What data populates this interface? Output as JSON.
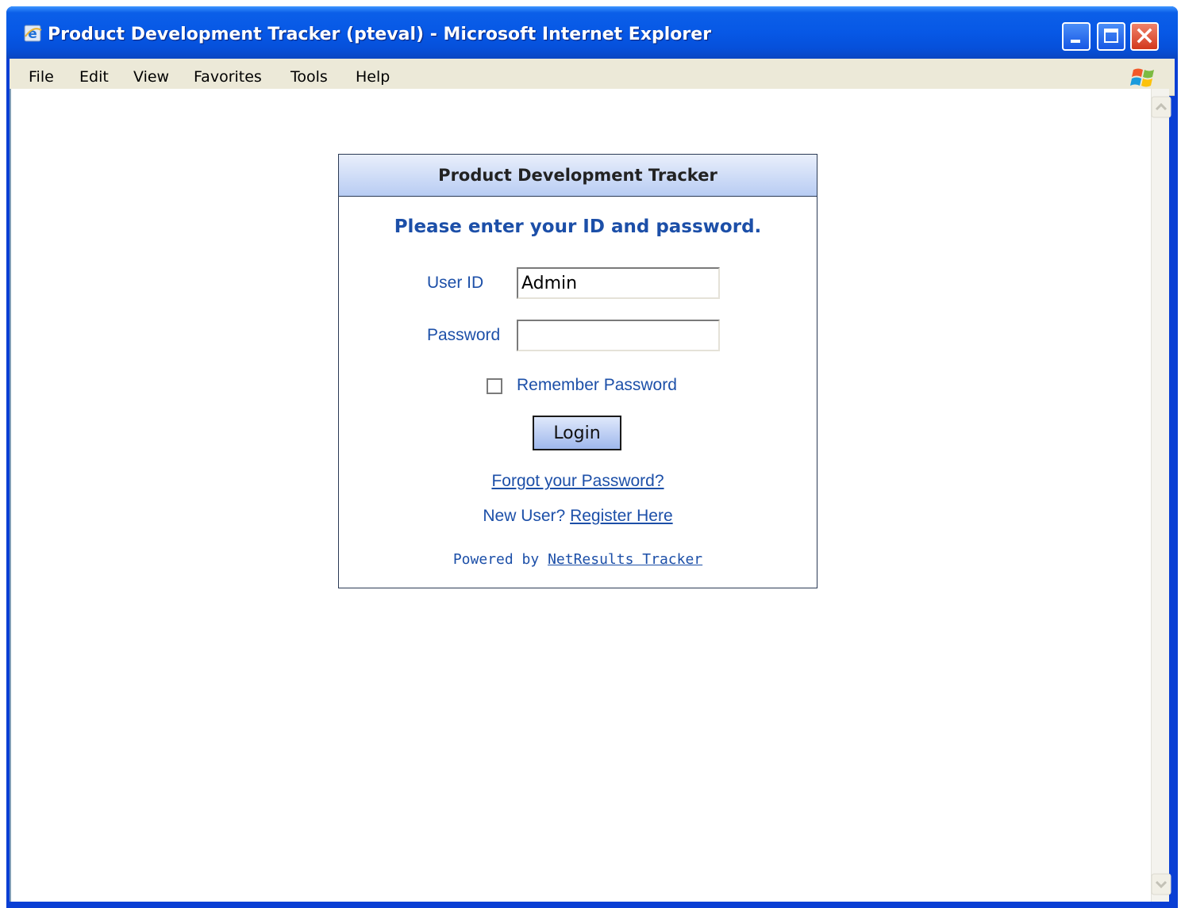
{
  "window": {
    "title": "Product Development Tracker (pteval) - Microsoft Internet Explorer"
  },
  "menubar": {
    "items": [
      {
        "label": "File"
      },
      {
        "label": "Edit"
      },
      {
        "label": "View"
      },
      {
        "label": "Favorites"
      },
      {
        "label": "Tools"
      },
      {
        "label": "Help"
      }
    ]
  },
  "login": {
    "header": "Product Development Tracker",
    "prompt": "Please enter your ID and password.",
    "user_id_label": "User ID",
    "user_id_value": "Admin",
    "password_label": "Password",
    "password_value": "",
    "remember_label": "Remember Password",
    "remember_checked": false,
    "button_label": "Login",
    "forgot_link": "Forgot your Password?",
    "new_user_text": "New User?",
    "register_link": "Register Here",
    "powered_by_text": "Powered by",
    "powered_by_link": "NetResults Tracker"
  },
  "colors": {
    "titlebar": "#0758e6",
    "link_text": "#1c4fa8",
    "panel_header": "#b8ccf3",
    "menubar": "#ece9d8"
  },
  "icons": {
    "app": "ie-icon",
    "menubar_logo": "windows-logo-icon"
  }
}
